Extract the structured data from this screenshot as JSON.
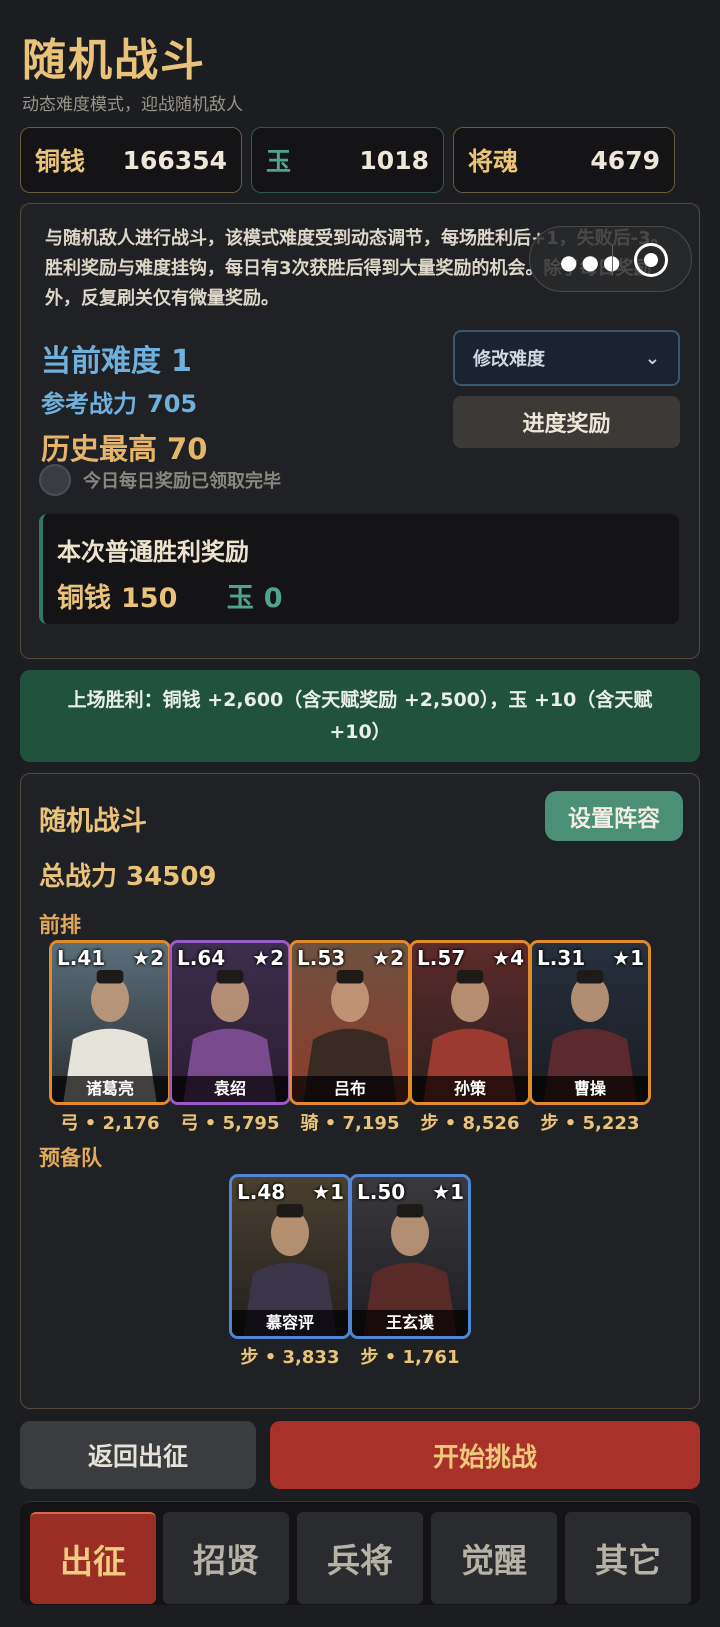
{
  "header": {
    "title": "随机战斗",
    "subtitle": "动态难度模式，迎战随机敌人"
  },
  "currencies": [
    {
      "name": "铜钱",
      "value": "166354"
    },
    {
      "name": "玉",
      "value": "1018"
    },
    {
      "name": "将魂",
      "value": "4679"
    }
  ],
  "info": {
    "description": "与随机敌人进行战斗，该模式难度受到动态调节，每场胜利后+1，失败后-3。胜利奖励与难度挂钩，每日有3次获胜后得到大量奖励的机会。除了每日奖励外，反复刷关仅有微量奖励。",
    "current_difficulty_label": "当前难度",
    "current_difficulty": "1",
    "ref_power_label": "参考战力",
    "ref_power": "705",
    "history_best_label": "历史最高",
    "history_best": "70",
    "modify_difficulty": "修改难度",
    "progress_reward": "进度奖励",
    "daily_claimed": "今日每日奖励已领取完毕"
  },
  "reward": {
    "title": "本次普通胜利奖励",
    "copper_label": "铜钱",
    "copper": "150",
    "jade_label": "玉",
    "jade": "0"
  },
  "last_win": "上场胜利：铜钱 +2,600（含天赋奖励 +2,500），玉 +10（含天赋+10）",
  "battle": {
    "title": "随机战斗",
    "set_lineup": "设置阵容",
    "total_power": "总战力 34509",
    "front_label": "前排",
    "reserve_label": "预备队",
    "front": [
      {
        "level": "L.41",
        "stars": "★2",
        "name": "诸葛亮",
        "info": "弓 • 2,176",
        "frame": "orange",
        "palette": [
          "#5a6e7a",
          "#e6e3da",
          "#2b2f33"
        ]
      },
      {
        "level": "L.64",
        "stars": "★2",
        "name": "袁绍",
        "info": "弓 • 5,795",
        "frame": "purple",
        "palette": [
          "#3d2e4e",
          "#7a4a8e",
          "#2a1d2e"
        ]
      },
      {
        "level": "L.53",
        "stars": "★2",
        "name": "吕布",
        "info": "骑 • 7,195",
        "frame": "orange",
        "palette": [
          "#6e5240",
          "#3a2a24",
          "#8e3a2a"
        ]
      },
      {
        "level": "L.57",
        "stars": "★4",
        "name": "孙策",
        "info": "步 • 8,526",
        "frame": "orange",
        "palette": [
          "#5e2a2a",
          "#9a3a30",
          "#2a2020"
        ]
      },
      {
        "level": "L.31",
        "stars": "★1",
        "name": "曹操",
        "info": "步 • 5,223",
        "frame": "orange",
        "palette": [
          "#27303e",
          "#5a2a2e",
          "#1a1c22"
        ]
      }
    ],
    "reserve": [
      {
        "level": "L.48",
        "stars": "★1",
        "name": "慕容评",
        "info": "步 • 3,833",
        "frame": "blue",
        "palette": [
          "#4a4030",
          "#3a3548",
          "#22201e"
        ]
      },
      {
        "level": "L.50",
        "stars": "★1",
        "name": "王玄谟",
        "info": "步 • 1,761",
        "frame": "blue",
        "palette": [
          "#3a3a3e",
          "#5a2a28",
          "#1e1e22"
        ]
      }
    ]
  },
  "actions": {
    "back": "返回出征",
    "start": "开始挑战"
  },
  "nav": [
    "出征",
    "招贤",
    "兵将",
    "觉醒",
    "其它"
  ],
  "overlay_icons": [
    "more-dots-icon",
    "record-target-icon"
  ],
  "colors": {
    "accent_gold": "#e9c37a",
    "jade": "#4fa58a",
    "primary_red": "#a8322a",
    "win_green": "#21523e"
  }
}
